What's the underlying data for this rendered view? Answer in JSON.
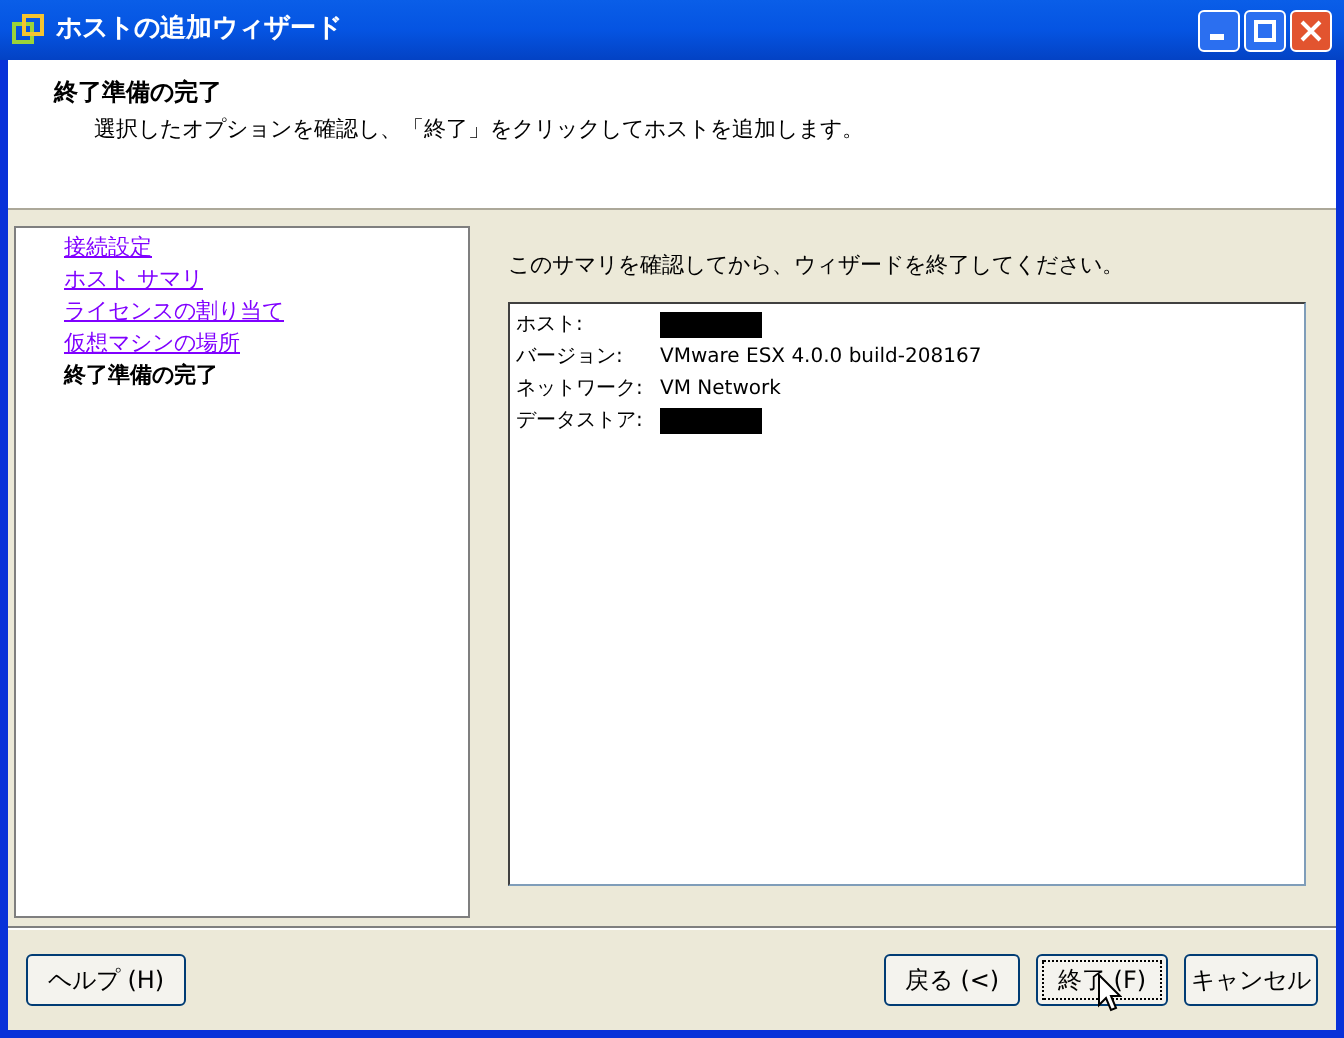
{
  "window": {
    "title": "ホストの追加ウィザード"
  },
  "header": {
    "title": "終了準備の完了",
    "description": "選択したオプションを確認し、「終了」をクリックしてホストを追加します。"
  },
  "steps": [
    {
      "label": "接続設定",
      "selected": false
    },
    {
      "label": "ホスト サマリ",
      "selected": false
    },
    {
      "label": "ライセンスの割り当て",
      "selected": false
    },
    {
      "label": "仮想マシンの場所",
      "selected": false
    },
    {
      "label": "終了準備の完了",
      "selected": true
    }
  ],
  "instruction": "このサマリを確認してから、ウィザードを終了してください。",
  "summary": [
    {
      "label": "ホスト:",
      "kind": "redacted"
    },
    {
      "label": "バージョン:",
      "kind": "text",
      "value": "VMware ESX 4.0.0 build-208167"
    },
    {
      "label": "ネットワーク:",
      "kind": "text",
      "value": "VM Network"
    },
    {
      "label": "データストア:",
      "kind": "redacted"
    }
  ],
  "buttons": {
    "help": "ヘルプ (H)",
    "back": "戻る (<)",
    "finish": "終了 (F)",
    "cancel": "キャンセル"
  }
}
